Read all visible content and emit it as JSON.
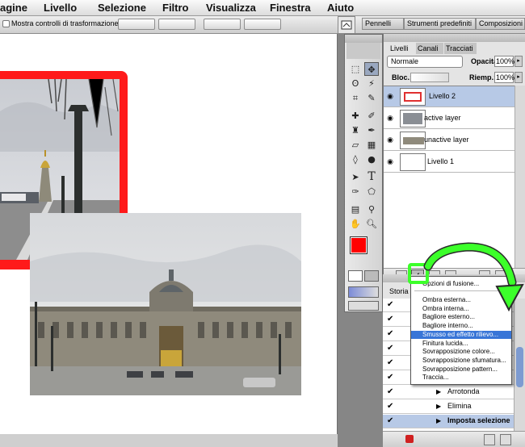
{
  "menubar": {
    "items": [
      "agine",
      "Livello",
      "Selezione",
      "Filtro",
      "Visualizza",
      "Finestra",
      "Aiuto"
    ]
  },
  "options_bar": {
    "show_transform_controls_label": "Mostra controlli di trasformazione",
    "palette_tabs": [
      "Pennelli",
      "Strumenti predefiniti",
      "Composizioni li"
    ]
  },
  "layers_panel": {
    "tabs": [
      "Livelli",
      "Canali",
      "Tracciati"
    ],
    "blend_mode": "Normale",
    "opacity_label": "Opacità:",
    "opacity_value": "100%",
    "lock_label": "Bloc.:",
    "fill_label": "Riemp.:",
    "fill_value": "100%",
    "layers": [
      {
        "name": "Livello 2",
        "selected": true
      },
      {
        "name": "active layer",
        "selected": false
      },
      {
        "name": "unactive layer",
        "selected": false
      },
      {
        "name": "Livello 1",
        "selected": false
      }
    ]
  },
  "fx_menu": {
    "items": [
      {
        "label": "Opzioni di fusione...",
        "highlighted": false
      },
      {
        "label": "Ombra esterna...",
        "highlighted": false
      },
      {
        "label": "Ombra interna...",
        "highlighted": false
      },
      {
        "label": "Bagliore esterno...",
        "highlighted": false
      },
      {
        "label": "Bagliore interno...",
        "highlighted": false
      },
      {
        "label": "Smusso ed effetto rilievo...",
        "highlighted": true
      },
      {
        "label": "Finitura lucida...",
        "highlighted": false
      },
      {
        "label": "Sovrapposizione colore...",
        "highlighted": false
      },
      {
        "label": "Sovrapposizione sfumatura...",
        "highlighted": false
      },
      {
        "label": "Sovrapposizione pattern...",
        "highlighted": false
      },
      {
        "label": "Traccia...",
        "highlighted": false
      }
    ]
  },
  "history_panel": {
    "tab": "Storia",
    "items": [
      "Arrotonda",
      "Elimina",
      "Imposta selezione"
    ]
  },
  "colors": {
    "foreground": "#ff0000",
    "background": "#000000",
    "highlight_arrow": "#3cff2a",
    "menu_highlight": "#3875d7"
  },
  "icons": [
    "move-tool-icon",
    "marquee-tool-icon",
    "lasso-tool-icon",
    "magic-wand-icon",
    "crop-icon",
    "slice-icon",
    "healing-brush-icon",
    "brush-icon",
    "clone-stamp-icon",
    "history-brush-icon",
    "eraser-icon",
    "gradient-icon",
    "blur-icon",
    "dodge-icon",
    "path-selection-icon",
    "type-tool-icon",
    "pen-tool-icon",
    "shape-tool-icon",
    "notes-icon",
    "eyedropper-icon",
    "hand-tool-icon",
    "zoom-tool-icon",
    "eye-icon",
    "fx-icon",
    "trash-icon"
  ]
}
